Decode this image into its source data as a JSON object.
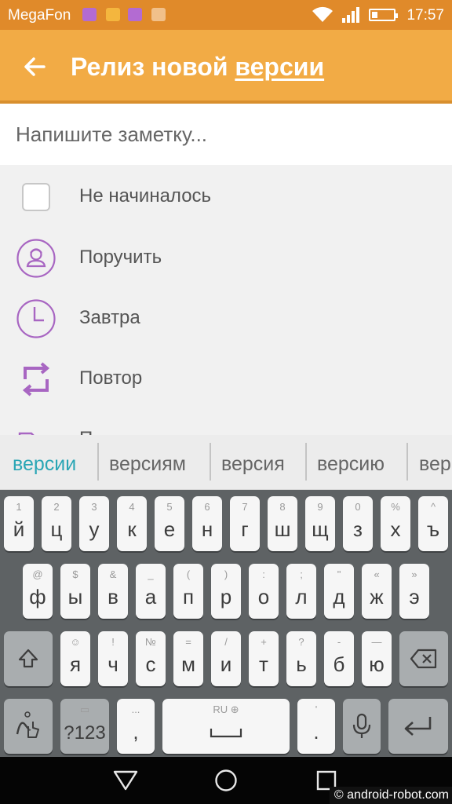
{
  "status_bar": {
    "carrier": "MegaFon",
    "time": "17:57",
    "battery_level": 0.25,
    "notification_icons": [
      "message-icon",
      "shop-icon",
      "image-icon",
      "mail-icon"
    ]
  },
  "app_bar": {
    "title_prefix": "Релиз новой ",
    "title_underlined": "версии",
    "background": "#f2ab45"
  },
  "note": {
    "placeholder": "Напишите заметку..."
  },
  "options": [
    {
      "label": "Не начиналось",
      "icon": "checkbox-icon"
    },
    {
      "label": "Поручить",
      "icon": "assign-person-icon"
    },
    {
      "label": "Завтра",
      "icon": "clock-icon"
    },
    {
      "label": "Повтор",
      "icon": "repeat-icon"
    },
    {
      "label": "П...",
      "icon": "folder-icon"
    }
  ],
  "suggestions": [
    "версии",
    "версиям",
    "версия",
    "версию",
    "вер"
  ],
  "keyboard": {
    "row1": [
      {
        "main": "й",
        "hint": "1"
      },
      {
        "main": "ц",
        "hint": "2"
      },
      {
        "main": "у",
        "hint": "3"
      },
      {
        "main": "к",
        "hint": "4"
      },
      {
        "main": "е",
        "hint": "5"
      },
      {
        "main": "н",
        "hint": "6"
      },
      {
        "main": "г",
        "hint": "7"
      },
      {
        "main": "ш",
        "hint": "8"
      },
      {
        "main": "щ",
        "hint": "9"
      },
      {
        "main": "з",
        "hint": "0"
      },
      {
        "main": "х",
        "hint": "%"
      },
      {
        "main": "ъ",
        "hint": "^"
      }
    ],
    "row2": [
      {
        "main": "ф",
        "hint": "@"
      },
      {
        "main": "ы",
        "hint": "$"
      },
      {
        "main": "в",
        "hint": "&"
      },
      {
        "main": "а",
        "hint": "_"
      },
      {
        "main": "п",
        "hint": "("
      },
      {
        "main": "р",
        "hint": ")"
      },
      {
        "main": "о",
        "hint": ":"
      },
      {
        "main": "л",
        "hint": ";"
      },
      {
        "main": "д",
        "hint": "\""
      },
      {
        "main": "ж",
        "hint": "«"
      },
      {
        "main": "э",
        "hint": "»"
      }
    ],
    "row3": [
      {
        "main": "я",
        "hint": "☺"
      },
      {
        "main": "ч",
        "hint": "!"
      },
      {
        "main": "с",
        "hint": "№"
      },
      {
        "main": "м",
        "hint": "="
      },
      {
        "main": "и",
        "hint": "/"
      },
      {
        "main": "т",
        "hint": "+"
      },
      {
        "main": "ь",
        "hint": "?"
      },
      {
        "main": "б",
        "hint": "-"
      },
      {
        "main": "ю",
        "hint": "—"
      }
    ],
    "symbols_label": "?123",
    "comma": ",",
    "comma_hint": "...",
    "space_hint": "RU",
    "period": ".",
    "period_hint": "'"
  },
  "watermark": "© android-robot.com"
}
